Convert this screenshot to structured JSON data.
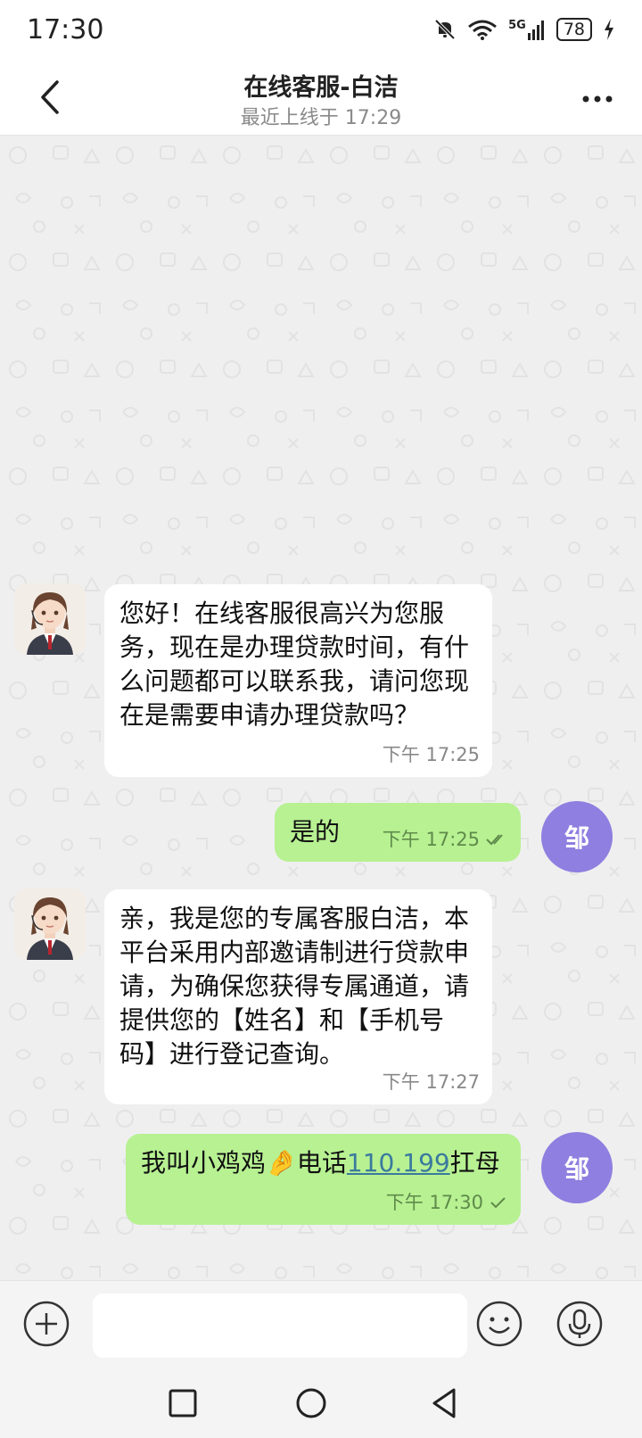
{
  "status_bar": {
    "time": "17:30",
    "network": "5G",
    "battery": "78",
    "icons": [
      "mute-bell-icon",
      "wifi-icon",
      "signal-icon",
      "battery-icon",
      "charging-icon"
    ]
  },
  "header": {
    "title": "在线客服-白洁",
    "subtitle": "最近上线于 17:29",
    "back_icon": "chevron-left-icon",
    "more_icon": "more-dots-icon"
  },
  "messages": [
    {
      "direction": "in",
      "text": "您好！在线客服很高兴为您服务，现在是办理贷款时间，有什么问题都可以联系我，请问您现在是需要申请办理贷款吗？",
      "time": "下午 17:25"
    },
    {
      "direction": "out",
      "text": "是的",
      "time": "下午 17:25",
      "status": "read"
    },
    {
      "direction": "in",
      "text": "亲，我是您的专属客服白洁，本平台采用内部邀请制进行贷款申请，为确保您获得专属通道，请提供您的【姓名】和【手机号码】进行登记查询。",
      "time": "下午 17:27"
    },
    {
      "direction": "out",
      "text_before": "我叫小鸡鸡",
      "emoji": "🤌",
      "text_middle": "电话",
      "link": "110.199",
      "text_after": "扛母",
      "time": "下午 17:30",
      "status": "sent"
    }
  ],
  "user_avatar_text": "邹",
  "input_bar": {
    "placeholder": "",
    "icons": [
      "add-icon",
      "emoji-icon",
      "microphone-icon"
    ]
  },
  "nav_bar": {
    "icons": [
      "recent-apps-icon",
      "home-icon",
      "back-triangle-icon"
    ]
  },
  "colors": {
    "outgoing_bubble": "#b7f192",
    "incoming_bubble": "#ffffff",
    "user_avatar": "#8e7fe0",
    "chat_background": "#efefef"
  }
}
